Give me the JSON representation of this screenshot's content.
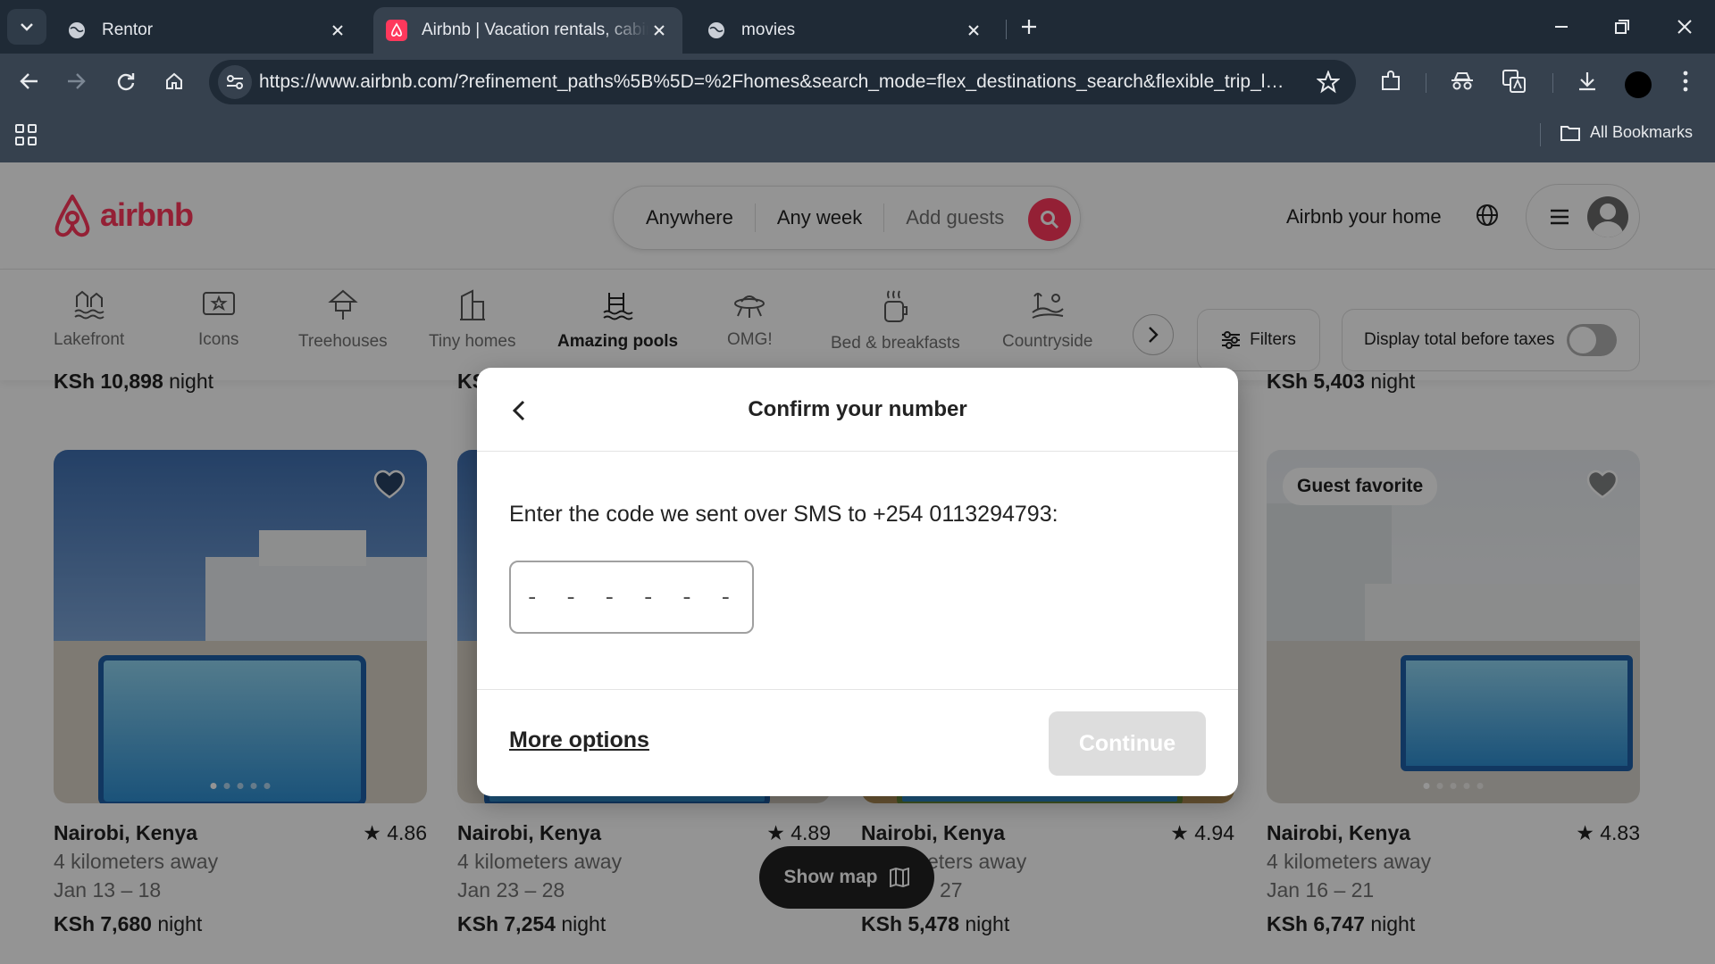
{
  "browser": {
    "tabs": [
      {
        "title": "Rentor",
        "icon": "globe-icon"
      },
      {
        "title": "Airbnb | Vacation rentals, cabins",
        "icon": "airbnb-icon",
        "active": true
      },
      {
        "title": "movies",
        "icon": "globe-icon"
      }
    ],
    "url": "https://www.airbnb.com/?refinement_paths%5B%5D=%2Fhomes&search_mode=flex_destinations_search&flexible_trip_len...",
    "bookmarks_label": "All Bookmarks"
  },
  "header": {
    "logo_text": "airbnb",
    "search": {
      "where": "Anywhere",
      "when": "Any week",
      "who": "Add guests"
    },
    "host_link": "Airbnb your home"
  },
  "categories": [
    {
      "label": "Lakefront",
      "icon": "lakefront-icon"
    },
    {
      "label": "Icons",
      "icon": "icons-icon"
    },
    {
      "label": "Treehouses",
      "icon": "treehouse-icon"
    },
    {
      "label": "Tiny homes",
      "icon": "tiny-home-icon"
    },
    {
      "label": "Amazing pools",
      "icon": "pool-icon",
      "active": true
    },
    {
      "label": "OMG!",
      "icon": "ufo-icon"
    },
    {
      "label": "Bed & breakfasts",
      "icon": "breakfast-icon"
    },
    {
      "label": "Countryside",
      "icon": "countryside-icon"
    }
  ],
  "filters_label": "Filters",
  "taxes_label": "Display total before taxes",
  "taxes_toggle_on": false,
  "previous_row_prices": [
    {
      "amount": "KSh 10,898",
      "unit": "night"
    },
    {
      "amount": "KS",
      "unit": ""
    },
    {
      "amount": "KSh 5,403",
      "unit": "night"
    }
  ],
  "listings": [
    {
      "title": "Nairobi, Kenya",
      "rating": "4.86",
      "distance": "4 kilometers away",
      "dates": "Jan 13 – 18",
      "price": "KSh 7,680",
      "unit": "night",
      "badge": ""
    },
    {
      "title": "Nairobi, Kenya",
      "rating": "4.89",
      "distance": "4 kilometers away",
      "dates": "Jan 23 – 28",
      "price": "KSh 7,254",
      "unit": "night",
      "badge": ""
    },
    {
      "title": "Nairobi, Kenya",
      "rating": "4.94",
      "distance": "eters away",
      "dates": "27",
      "price": "KSh 5,478",
      "unit": "night",
      "badge": ""
    },
    {
      "title": "Nairobi, Kenya",
      "rating": "4.83",
      "distance": "4 kilometers away",
      "dates": "Jan 16 – 21",
      "price": "KSh 6,747",
      "unit": "night",
      "badge": "Guest favorite"
    }
  ],
  "show_map_label": "Show map",
  "modal": {
    "title": "Confirm your number",
    "instruction": "Enter the code we sent over SMS to +254 0113294793:",
    "code_placeholder": "- - - - - -",
    "more_options": "More options",
    "continue": "Continue"
  },
  "colors": {
    "brand": "#ff385c",
    "chrome_dark": "#1f2a36",
    "chrome": "#36414e",
    "continue_disabled": "#dddddd"
  }
}
